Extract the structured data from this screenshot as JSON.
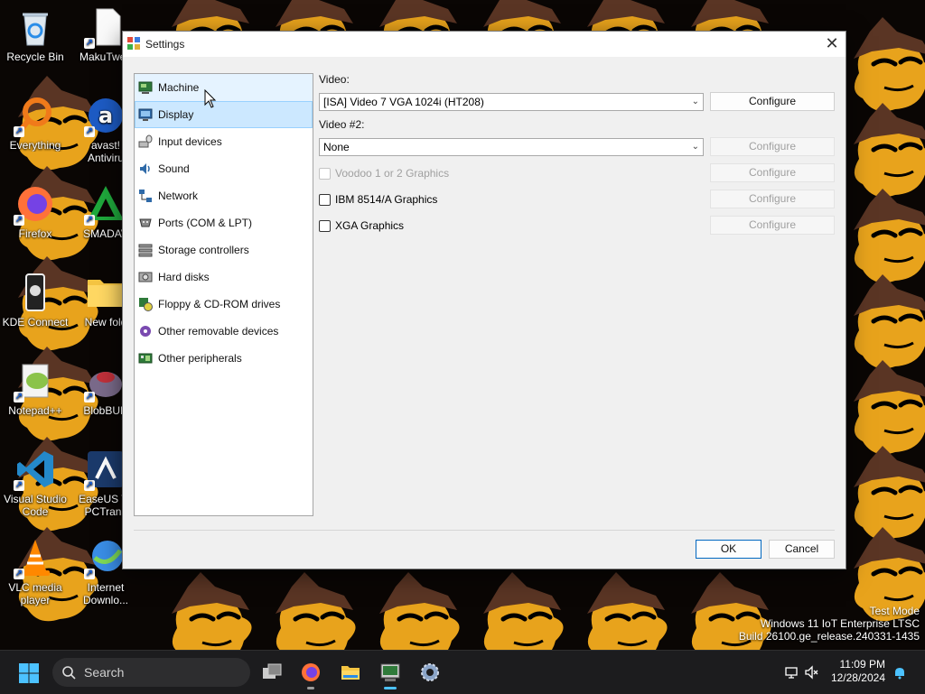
{
  "desktop": {
    "icons": [
      {
        "label": "Recycle Bin",
        "icon": "recycle-bin-icon"
      },
      {
        "label": "MakuTwea",
        "icon": "file-icon"
      },
      {
        "label": "Everything",
        "icon": "everything-icon"
      },
      {
        "label": "avast!",
        "label2": "Antiviru",
        "icon": "avast-icon"
      },
      {
        "label": "Firefox",
        "icon": "firefox-icon"
      },
      {
        "label": "SMADAV",
        "icon": "smadav-icon"
      },
      {
        "label": "KDE Connect",
        "icon": "kde-connect-icon"
      },
      {
        "label": "New fold",
        "icon": "folder-icon"
      },
      {
        "label": "Notepad++",
        "icon": "notepad-plus-plus-icon"
      },
      {
        "label": "BlobBUD",
        "icon": "blobbud-icon"
      },
      {
        "label": "Visual Studio",
        "label2": "Code",
        "icon": "vscode-icon"
      },
      {
        "label": "EaseUS To",
        "label2": "PCTrans",
        "icon": "easeus-icon"
      },
      {
        "label": "VLC media",
        "label2": "player",
        "icon": "vlc-icon"
      },
      {
        "label": "Internet",
        "label2": "Downlo...",
        "icon": "internet-download-icon"
      }
    ],
    "watermark": {
      "line1": "Test Mode",
      "line2": "Windows 11 IoT Enterprise LTSC",
      "line3": "Build 26100.ge_release.240331-1435"
    }
  },
  "window": {
    "title": "Settings",
    "close_glyph": "✕",
    "categories": [
      {
        "label": "Machine",
        "icon": "machine-icon",
        "state": "hover"
      },
      {
        "label": "Display",
        "icon": "display-icon",
        "state": "selected"
      },
      {
        "label": "Input devices",
        "icon": "input-devices-icon",
        "state": ""
      },
      {
        "label": "Sound",
        "icon": "sound-icon",
        "state": ""
      },
      {
        "label": "Network",
        "icon": "network-icon",
        "state": ""
      },
      {
        "label": "Ports (COM & LPT)",
        "icon": "ports-icon",
        "state": ""
      },
      {
        "label": "Storage controllers",
        "icon": "storage-controllers-icon",
        "state": ""
      },
      {
        "label": "Hard disks",
        "icon": "hard-disks-icon",
        "state": ""
      },
      {
        "label": "Floppy & CD-ROM drives",
        "icon": "floppy-cdrom-icon",
        "state": ""
      },
      {
        "label": "Other removable devices",
        "icon": "removable-devices-icon",
        "state": ""
      },
      {
        "label": "Other peripherals",
        "icon": "peripherals-icon",
        "state": ""
      }
    ],
    "display": {
      "video_label": "Video:",
      "video_value": "[ISA] Video 7 VGA 1024i (HT208)",
      "video2_label": "Video #2:",
      "video2_value": "None",
      "configure_label": "Configure",
      "options": [
        {
          "label": "Voodoo 1 or 2 Graphics",
          "checked": false,
          "enabled": false
        },
        {
          "label": "IBM 8514/A Graphics",
          "checked": false,
          "enabled": true
        },
        {
          "label": "XGA Graphics",
          "checked": false,
          "enabled": true
        }
      ]
    },
    "ok_label": "OK",
    "cancel_label": "Cancel"
  },
  "taskbar": {
    "search_placeholder": "Search",
    "time": "11:09 PM",
    "date": "12/28/2024",
    "apps": [
      {
        "name": "task-view",
        "active": false
      },
      {
        "name": "firefox",
        "active": false
      },
      {
        "name": "file-explorer",
        "active": false
      },
      {
        "name": "86box",
        "active": true
      },
      {
        "name": "settings",
        "active": false
      }
    ]
  },
  "colors": {
    "accent": "#0067c0",
    "selection": "#cce8ff",
    "hover": "#e5f3ff",
    "taskbar": "#1c1c1e",
    "wallpaper": "#0a0604",
    "wallpaper_face": "#e8a31c",
    "wallpaper_hat": "#5a3524"
  }
}
